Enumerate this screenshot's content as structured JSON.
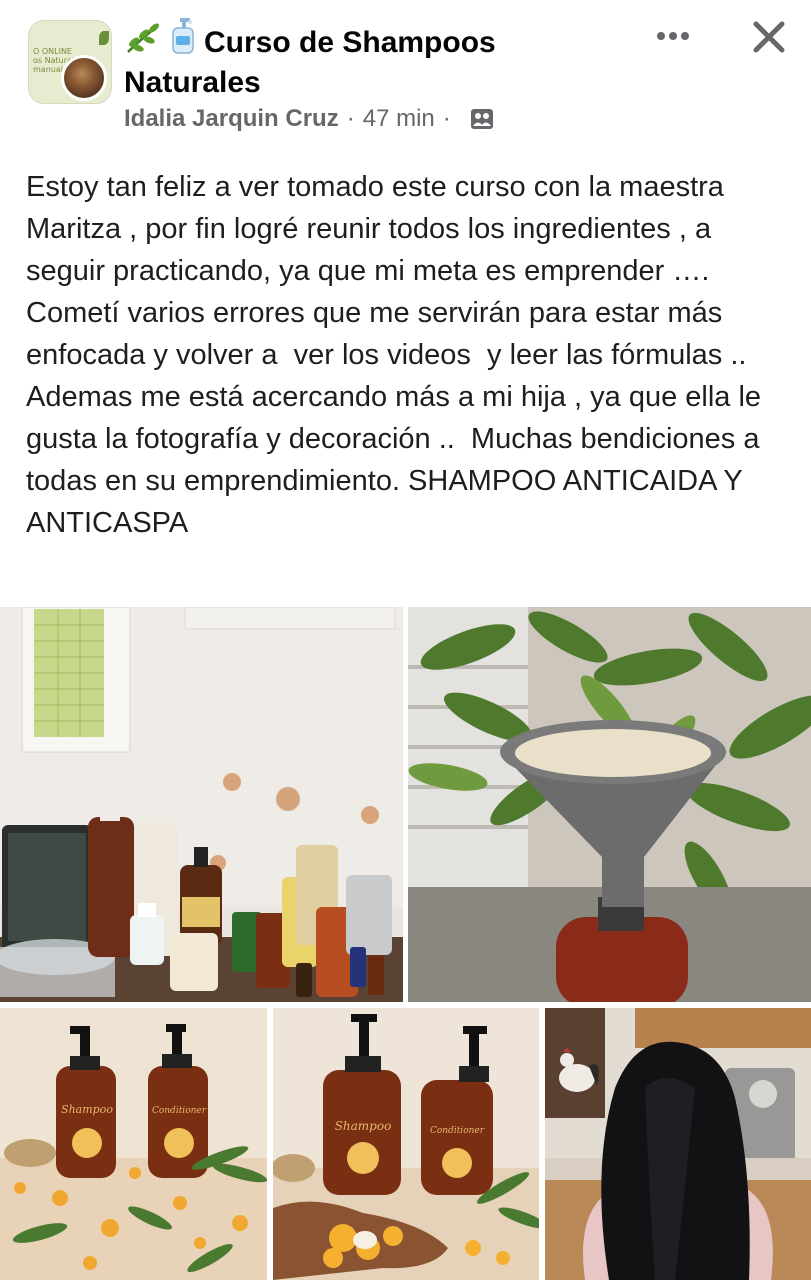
{
  "post": {
    "group_name": "Curso de Shampoos Naturales",
    "group_avatar_text": "O ONLINE\nos Naturales\nmanuales",
    "author": "Idalia Jarquin Cruz",
    "separator": "·",
    "time": "47 min",
    "audience_icon": "group-audience-icon",
    "title_icons": [
      "herb-icon",
      "soap-bottle-icon"
    ],
    "body": "Estoy tan feliz a ver tomado este curso con la maestra Maritza , por fin logré reunir todos los ingredientes , a seguir practicando, ya que mi meta es emprender …. Cometí varios errores que me servirán para estar más enfocada y volver a  ver los videos  y leer las fórmulas .. Ademas me está acercando más a mi hija , ya que ella le gusta la fotografía y decoración ..  Muchas bendiciones a todas en su emprendimiento. SHAMPOO ANTICAIDA Y ANTICASPA"
  },
  "header_actions": {
    "more_icon": "more-horizontal-icon",
    "close_icon": "close-icon"
  },
  "photos": [
    {
      "name": "photo-ingredients-table"
    },
    {
      "name": "photo-funnel-bottle"
    },
    {
      "name": "photo-shampoo-conditioner-bottles"
    },
    {
      "name": "photo-bottles-with-flowers"
    },
    {
      "name": "photo-long-hair-result"
    }
  ],
  "bottle_labels": {
    "shampoo": "Shampoo",
    "conditioner": "Conditioner"
  },
  "colors": {
    "text_primary": "#050505",
    "text_secondary": "#65676b",
    "bottle_amber": "#7a2e12",
    "pump_black": "#1a1a1a"
  }
}
